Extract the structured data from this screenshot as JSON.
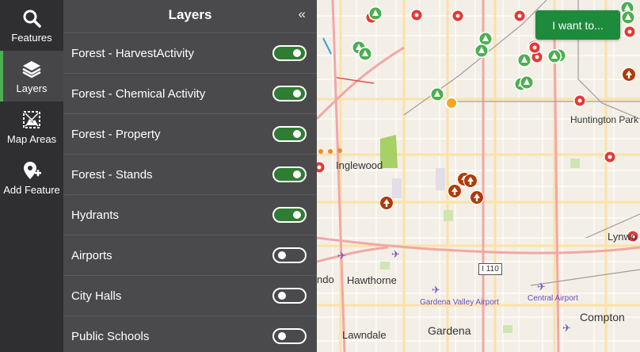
{
  "rail": {
    "items": [
      {
        "label": "Features",
        "icon": "search-icon",
        "active": false
      },
      {
        "label": "Layers",
        "icon": "layers-icon",
        "active": true
      },
      {
        "label": "Map Areas",
        "icon": "map-areas-icon",
        "active": false
      },
      {
        "label": "Add Feature",
        "icon": "add-location-icon",
        "active": false
      }
    ]
  },
  "panel": {
    "title": "Layers",
    "collapse_glyph": "«",
    "layers": [
      {
        "label": "Forest - HarvestActivity",
        "enabled": true
      },
      {
        "label": "Forest - Chemical Activity",
        "enabled": true
      },
      {
        "label": "Forest - Property",
        "enabled": true
      },
      {
        "label": "Forest - Stands",
        "enabled": true
      },
      {
        "label": "Hydrants",
        "enabled": true
      },
      {
        "label": "Airports",
        "enabled": false
      },
      {
        "label": "City Halls",
        "enabled": false
      },
      {
        "label": "Public Schools",
        "enabled": false
      }
    ]
  },
  "map": {
    "action_button": "I want to...",
    "places": {
      "inglewood": "Inglewood",
      "hawthorne": "Hawthorne",
      "lawndale": "Lawndale",
      "gardena": "Gardena",
      "compton": "Compton",
      "lynwood": "Lynwo",
      "huntington_park": "Huntington Park",
      "ndo": "ndo",
      "gardena_airport": "Gardena Valley Airport",
      "central_airport": "Central Airport"
    },
    "highway_shield": "I 110",
    "colors": {
      "accent_green": "#1e8a3c",
      "toggle_on": "#2e7d32",
      "hydrant_red": "#e53935",
      "forest_green": "#4caf50",
      "property_brown": "#b23a06"
    }
  }
}
